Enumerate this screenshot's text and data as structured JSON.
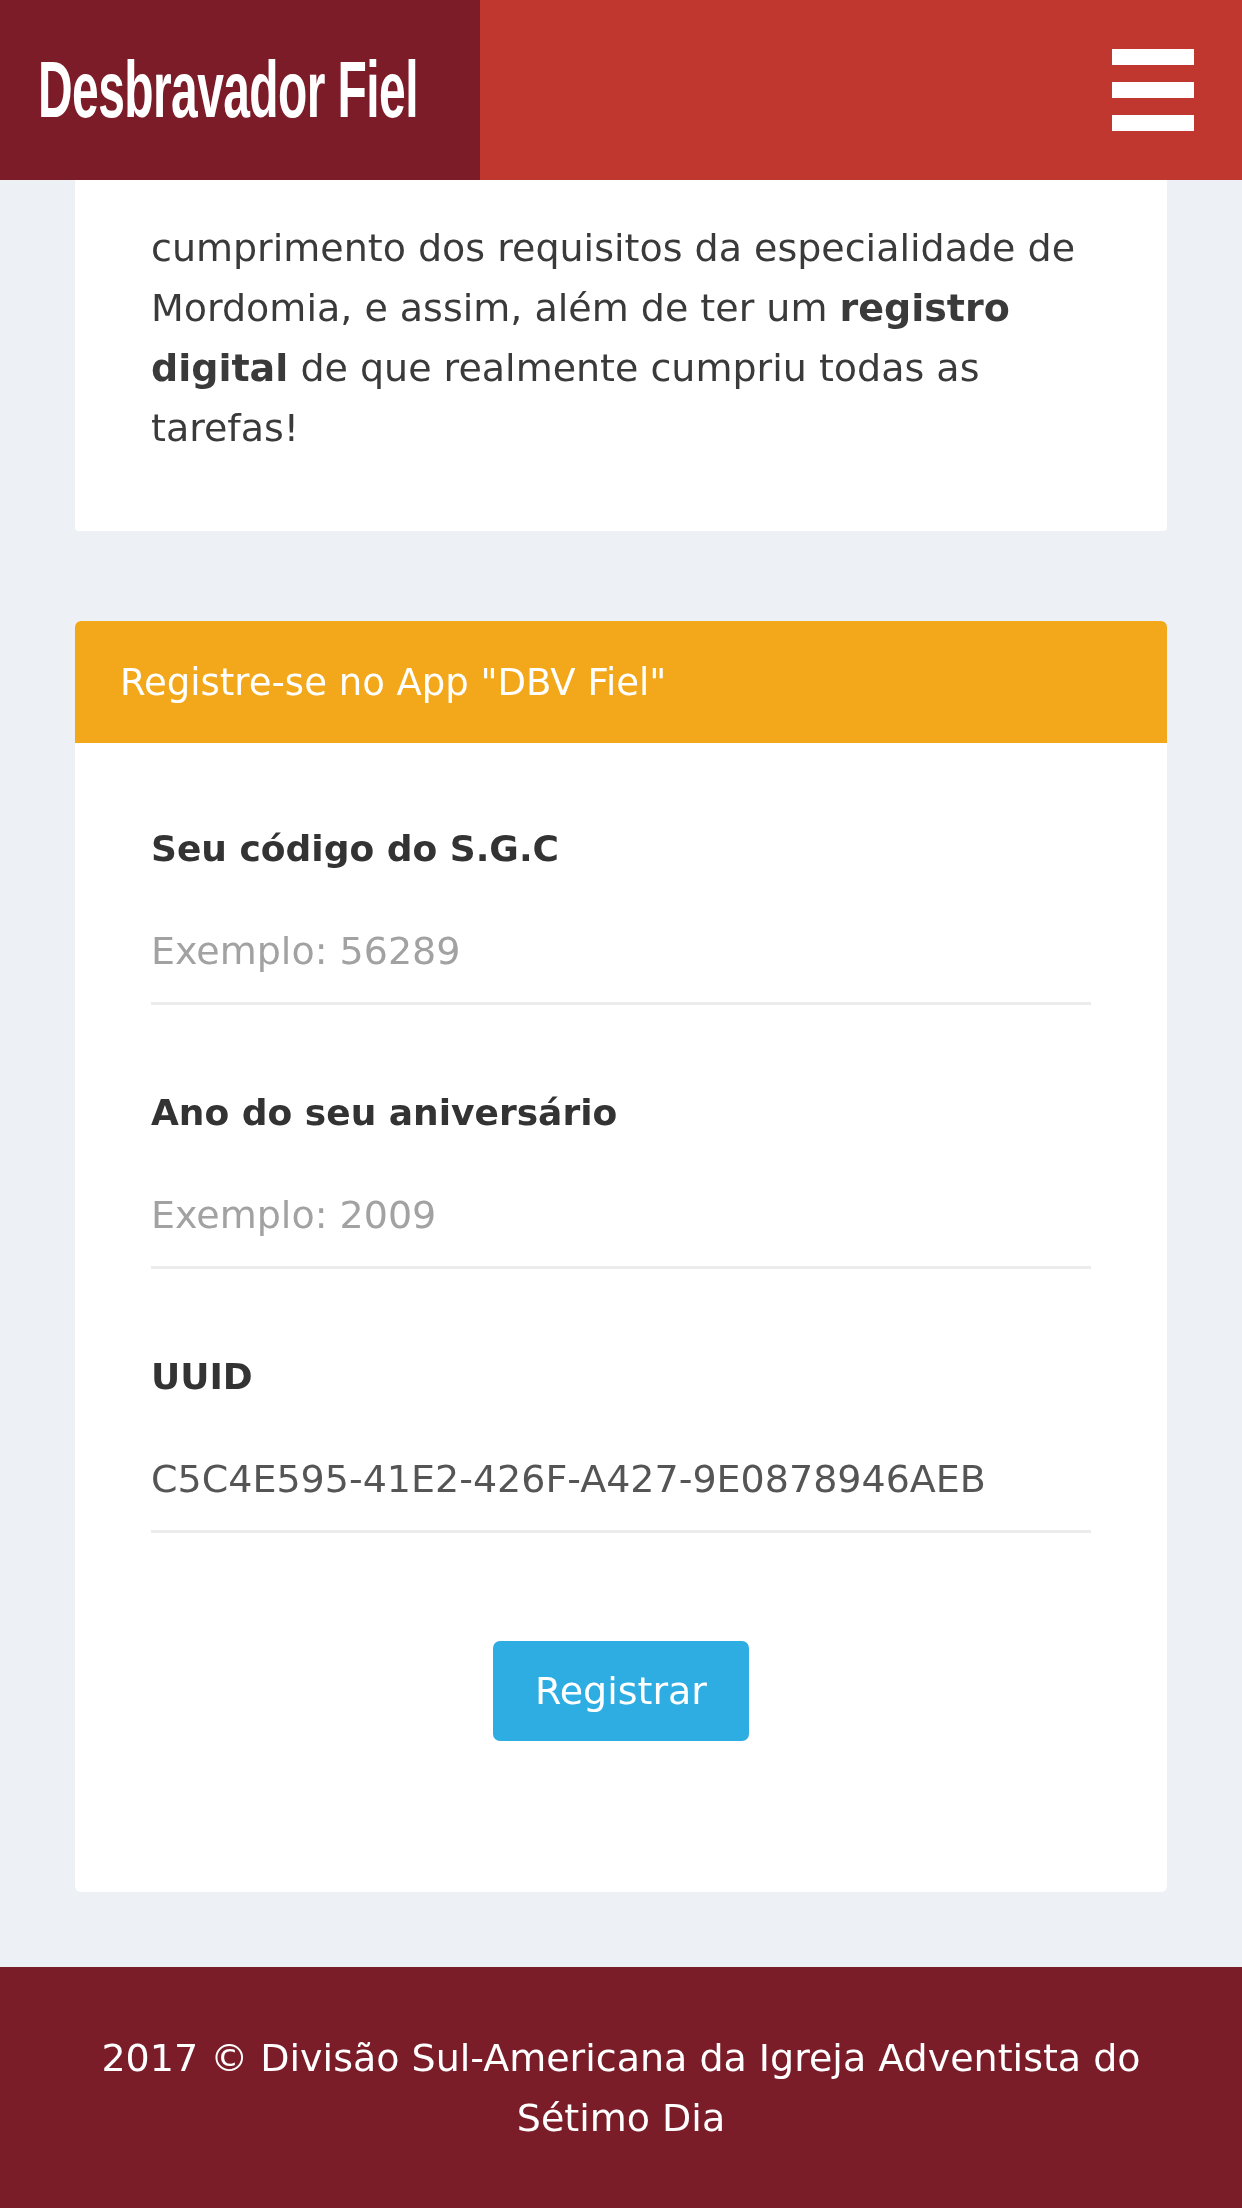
{
  "header": {
    "logo": "Desbravador Fiel"
  },
  "intro": {
    "text": "cumprimento dos requisitos da especialidade de Mordomia, e assim, além de ter um **registro digital** de que realmente cumpriu todas as tarefas!"
  },
  "register_card": {
    "title": "Registre-se no App \"DBV Fiel\"",
    "fields": [
      {
        "label": "Seu código do S.G.C",
        "placeholder": "Exemplo: 56289"
      },
      {
        "label": "Ano do seu aniversário",
        "placeholder": "Exemplo: 2009"
      },
      {
        "label": "UUID",
        "value": "C5C4E595-41E2-426F-A427-9E0878946AEB"
      }
    ],
    "button": "Registrar"
  },
  "footer": {
    "text": "2017 © Divisão Sul-Americana da Igreja Adventista do Sétimo Dia"
  }
}
